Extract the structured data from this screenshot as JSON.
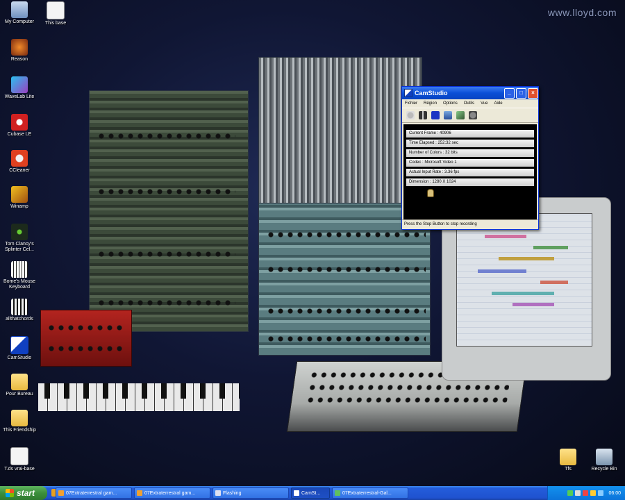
{
  "desktop": {
    "watermark": "www.lloyd.com",
    "icons": [
      {
        "label": "My Computer",
        "icon": "my-computer-icon"
      },
      {
        "label": "This base",
        "icon": "document-icon"
      },
      {
        "label": "Reason",
        "icon": "reason-app-icon"
      },
      {
        "label": "WaveLab Lite",
        "icon": "wavelab-app-icon"
      },
      {
        "label": "Cubase LE",
        "icon": "cubase-app-icon"
      },
      {
        "label": "CCleaner",
        "icon": "ccleaner-app-icon"
      },
      {
        "label": "Winamp",
        "icon": "winamp-app-icon"
      },
      {
        "label": "Tom Clancy's Splinter Cel...",
        "icon": "game-app-icon"
      },
      {
        "label": "Bome's Mouse Keyboard",
        "icon": "keyboard-app-icon"
      },
      {
        "label": "allthatchords",
        "icon": "chords-app-icon"
      },
      {
        "label": "CamStudio",
        "icon": "camstudio-app-icon"
      },
      {
        "label": "Pour Bureau",
        "icon": "folder-icon"
      },
      {
        "label": "This Friendship",
        "icon": "folder-icon"
      },
      {
        "label": "T.ds vrai-base",
        "icon": "document-icon"
      },
      {
        "label": "Tfs",
        "icon": "folder-icon"
      },
      {
        "label": "Recycle Bin",
        "icon": "recycle-bin-icon"
      }
    ]
  },
  "camstudio": {
    "title": "CamStudio",
    "menu": [
      "Fichier",
      "Région",
      "Options",
      "Outils",
      "Vue",
      "Aide"
    ],
    "toolbar_icons": [
      "record-icon",
      "pause-icon",
      "stop-icon",
      "camera-icon",
      "annotation-icon",
      "screen-icon"
    ],
    "stats": [
      "Current Frame : 40906",
      "Time Elapsed : 252:32 sec",
      "Number of Colors : 32 bits",
      "Codec : Microsoft Video 1",
      "Actual Input Rate : 3.36 fps",
      "Dimension : 1280 X 1024"
    ],
    "status": "Press the Stop Button to stop recording"
  },
  "taskbar": {
    "start_label": "start",
    "tasks": [
      {
        "label": "07Extraterrestral gam...",
        "active": false,
        "icon": "winamp-task-icon"
      },
      {
        "label": "07Extraterrestral gam...",
        "active": false,
        "icon": "winamp-task-icon"
      },
      {
        "label": "Flashing",
        "active": false,
        "icon": "paint-task-icon"
      },
      {
        "label": "CamSt...",
        "active": true,
        "icon": "camstudio-task-icon"
      },
      {
        "label": "07Extraterrestral-Gal...",
        "active": false,
        "icon": "media-task-icon"
      }
    ],
    "clock": "06:00"
  },
  "colors": {
    "taskbar_blue": "#245ddb",
    "start_green": "#3c8f3c",
    "title_blue": "#0a4fd6"
  }
}
